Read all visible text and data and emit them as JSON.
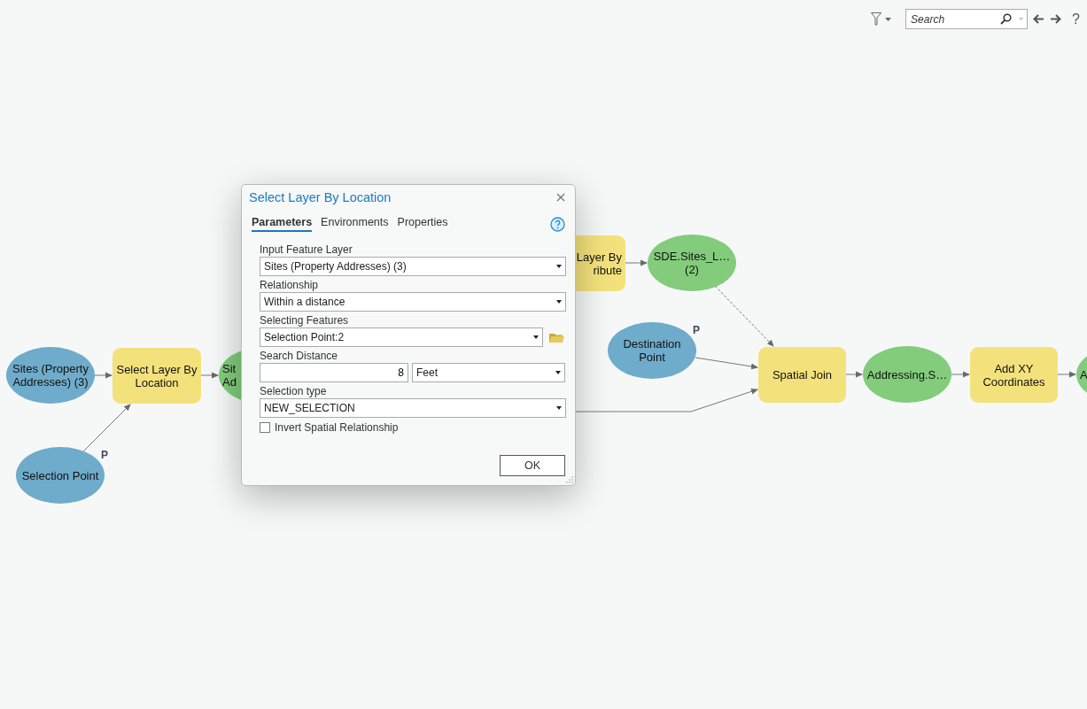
{
  "toolbar": {
    "search": {
      "placeholder": "Search"
    },
    "help": "?"
  },
  "nodes": [
    {
      "kind": "input",
      "label": "Sites (Property Addresses) (3)"
    },
    {
      "kind": "tool",
      "label": "Select Layer By Location"
    },
    {
      "kind": "output",
      "label": "Sit\nAd"
    },
    {
      "kind": "tool",
      "label": "Layer By\nribute"
    },
    {
      "kind": "output",
      "label": "SDE.Sites_L…\n(2)"
    },
    {
      "kind": "input",
      "label": "Destination Point",
      "badge": "P"
    },
    {
      "kind": "tool",
      "label": "Spatial Join"
    },
    {
      "kind": "output",
      "label": "Addressing.S…"
    },
    {
      "kind": "tool",
      "label": "Add XY Coordinates"
    },
    {
      "kind": "output",
      "label": "A"
    },
    {
      "kind": "input",
      "label": "Selection Point",
      "badge": "P"
    }
  ],
  "dialog": {
    "title": "Select Layer By Location",
    "tabs": [
      {
        "label": "Parameters",
        "selected": true
      },
      {
        "label": "Environments",
        "selected": false
      },
      {
        "label": "Properties",
        "selected": false
      }
    ],
    "fields": [
      {
        "kind": "dropdown",
        "label": "Input Feature Layer",
        "value": "Sites (Property Addresses) (3)"
      },
      {
        "kind": "dropdown",
        "label": "Relationship",
        "value": "Within a distance"
      },
      {
        "kind": "browse",
        "label": "Selecting Features",
        "value": "Selection Point:2"
      },
      {
        "kind": "distance",
        "label": "Search Distance",
        "value": "8",
        "unit": "Feet"
      },
      {
        "kind": "dropdown",
        "label": "Selection type",
        "value": "NEW_SELECTION"
      },
      {
        "kind": "checkbox",
        "label": "Invert Spatial Relationship",
        "checked": false
      }
    ],
    "ok": "OK"
  }
}
